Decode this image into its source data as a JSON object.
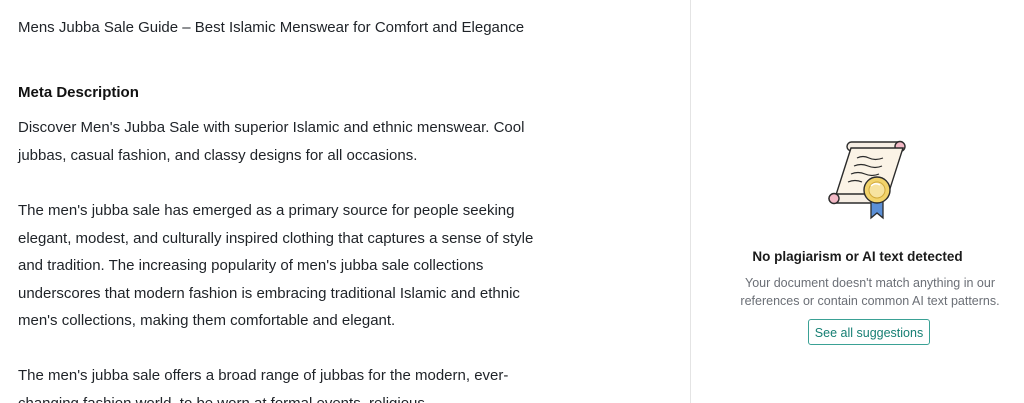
{
  "editor": {
    "title_text": "Mens Jubba Sale Guide – Best Islamic Menswear for Comfort and Elegance",
    "meta_heading": "Meta Description",
    "meta_text": "Discover Men's Jubba Sale with superior Islamic and ethnic menswear. Cool jubbas, casual fashion, and classy designs for all occasions.",
    "paragraph1": "The men's jubba sale has emerged as a primary source for people seeking elegant, modest, and culturally inspired clothing that captures a sense of style and tradition. The increasing popularity of men's jubba sale collections underscores that modern fashion is embracing traditional Islamic and ethnic men's collections, making them comfortable and elegant.",
    "paragraph2": "The men's jubba sale offers a broad range of jubbas for the modern, ever-changing fashion world, to be worn at formal events, religious"
  },
  "sidebar": {
    "illustration": "certificate-scroll-icon",
    "title": "No plagiarism or AI text detected",
    "description": "Your document doesn't match anything in our references or contain common AI text patterns.",
    "button_label": "See all suggestions",
    "accent_color": "#167f73"
  }
}
